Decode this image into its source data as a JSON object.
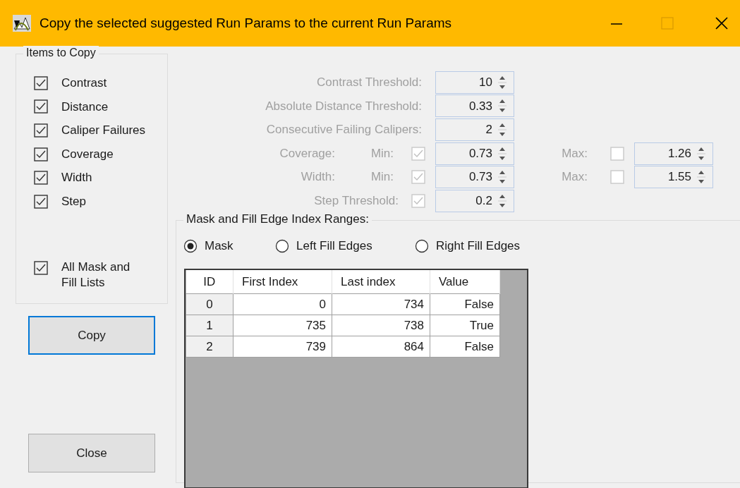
{
  "window": {
    "title": "Copy the selected suggested Run Params to the current Run Params"
  },
  "items_to_copy": {
    "title": "Items to Copy",
    "items": [
      {
        "label": "Contrast",
        "checked": true
      },
      {
        "label": "Distance",
        "checked": true
      },
      {
        "label": "Caliper Failures",
        "checked": true
      },
      {
        "label": "Coverage",
        "checked": true
      },
      {
        "label": "Width",
        "checked": true
      },
      {
        "label": "Step",
        "checked": true
      },
      {
        "label": "All Mask and Fill Lists",
        "checked": true
      }
    ]
  },
  "buttons": [
    {
      "label": "Copy",
      "focused": true
    },
    {
      "label": "Close",
      "focused": false
    }
  ],
  "parameters": [
    {
      "kind": "spin",
      "label": "Contrast Threshold:",
      "value": "10"
    },
    {
      "kind": "spin",
      "label": "Absolute Distance Threshold:",
      "value": "0.33"
    },
    {
      "kind": "spin",
      "label": "Consecutive Failing Calipers:",
      "value": "2"
    },
    {
      "kind": "range",
      "label": "Coverage:",
      "min": {
        "label": "Min:",
        "checked": true,
        "value": "0.73"
      },
      "max": {
        "label": "Max:",
        "checked": false,
        "value": "1.26"
      }
    },
    {
      "kind": "range",
      "label": "Width:",
      "min": {
        "label": "Min:",
        "checked": true,
        "value": "0.73"
      },
      "max": {
        "label": "Max:",
        "checked": false,
        "value": "1.55"
      }
    },
    {
      "kind": "checked_spin",
      "label": "Step Threshold:",
      "checked": true,
      "value": "0.2"
    }
  ],
  "ranges": {
    "title": "Mask and Fill Edge Index Ranges:",
    "options": [
      {
        "label": "Mask",
        "selected": true
      },
      {
        "label": "Left Fill Edges",
        "selected": false
      },
      {
        "label": "Right Fill Edges",
        "selected": false
      }
    ],
    "table": {
      "columns": [
        "ID",
        "First Index",
        "Last index",
        "Value"
      ],
      "rows": [
        [
          "0",
          "0",
          "734",
          "False"
        ],
        [
          "1",
          "735",
          "738",
          "True"
        ],
        [
          "2",
          "739",
          "864",
          "False"
        ]
      ]
    }
  }
}
